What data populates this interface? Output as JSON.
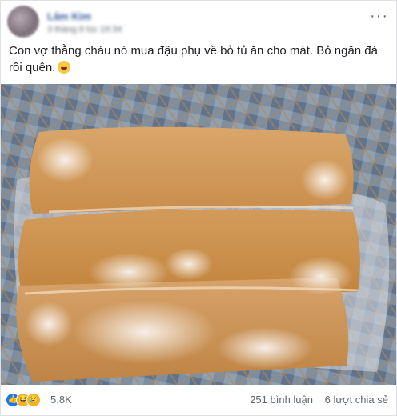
{
  "post": {
    "author_name": "Lâm Kim",
    "timestamp": "3 tháng 8 lúc 19:34",
    "more_label": "···",
    "caption": "Con vợ thằng cháu nó mua đậu phụ về bỏ tủ ăn cho mát. Bỏ ngăn đá rồi quên.",
    "caption_emoji": "laughing-crying-emoji"
  },
  "footer": {
    "reaction_icons": [
      "like-icon",
      "haha-icon",
      "sad-icon"
    ],
    "reaction_count": "5,8K",
    "comments": "251 bình luận",
    "shares": "6 lượt chia sẻ"
  },
  "colors": {
    "link": "#385898",
    "text": "#1c1e21",
    "secondary": "#606770",
    "like_blue": "#1877f2",
    "reaction_yellow": "#f7b125"
  }
}
